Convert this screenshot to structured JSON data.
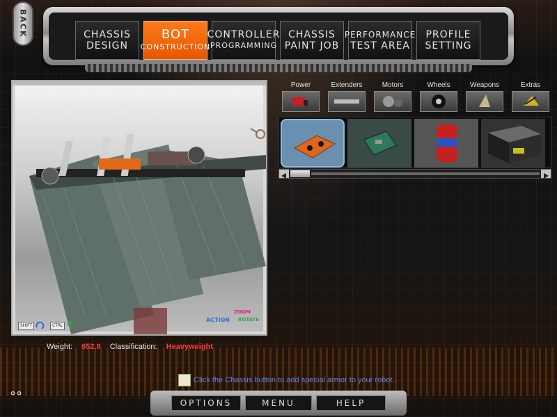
{
  "back_button": {
    "label": "BACK"
  },
  "nav": {
    "tabs": [
      {
        "line1": "CHASSIS",
        "line2": "DESIGN",
        "active": false
      },
      {
        "line1": "BOT",
        "line2": "CONSTRUCTION",
        "active": true
      },
      {
        "line1": "CONTROLLER",
        "line2": "PROGRAMMING",
        "active": false
      },
      {
        "line1": "CHASSIS",
        "line2": "PAINT JOB",
        "active": false
      },
      {
        "line1": "PERFORMANCE",
        "line2": "TEST AREA",
        "active": false
      },
      {
        "line1": "PROFILE",
        "line2": "SETTING",
        "active": false
      }
    ]
  },
  "viewport": {
    "shift_key": "SHIFT",
    "ctrl_key": "CTRL",
    "action_label": "ACTION",
    "zoom_label": "ZOOM",
    "rotate_label": "ROTATE"
  },
  "stats": {
    "weight_label": "Weight:",
    "weight_value": "652.8",
    "class_label": "Classification:",
    "class_value": "Heavyweight"
  },
  "parts": {
    "categories": [
      "Power",
      "Extenders",
      "Motors",
      "Wheels",
      "Weapons",
      "Extras"
    ],
    "items": [
      "battery-pack",
      "control-board",
      "power-cell",
      "armored-box"
    ]
  },
  "tip": {
    "text": "Click the Chassis button to add special armor to your robot."
  },
  "bottom": {
    "options": "OPTIONS",
    "menu": "MENU",
    "help": "HELP"
  },
  "colors": {
    "accent": "#ff6a00",
    "warn": "#ff3a3a",
    "tip": "#5b83e8"
  }
}
